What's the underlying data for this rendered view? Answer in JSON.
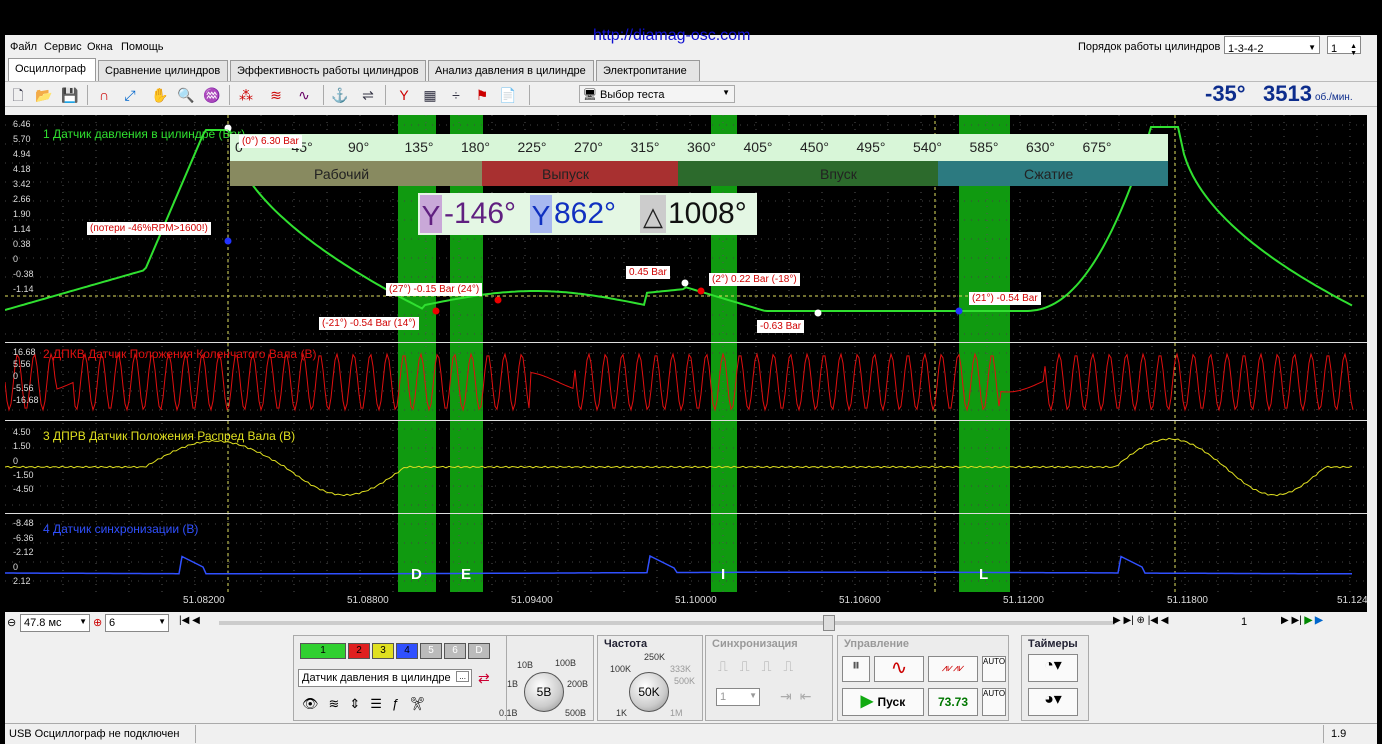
{
  "url": "http://diamag-osc.com",
  "menu": [
    "Файл",
    "Сервис",
    "Окна",
    "Помощь"
  ],
  "cyl_order": {
    "label": "Порядок работы цилиндров",
    "value": "1-3-4-2",
    "count": "1"
  },
  "tabs": [
    "Осциллограф",
    "Сравнение цилиндров",
    "Эффективность работы цилиндров",
    "Анализ давления в цилиндре",
    "Электропитание"
  ],
  "test_select": "Выбор теста",
  "readout": {
    "angle": "-35°",
    "rpm": "3513",
    "rpm_unit": "об./мин."
  },
  "channels": [
    {
      "label": "1 Датчик давления в цилиндре (Bar)",
      "color": "#30e030",
      "ticks": [
        "6.46",
        "5.70",
        "4.94",
        "4.18",
        "3.42",
        "2.66",
        "1.90",
        "1.14",
        "0.38",
        "0",
        "-0.38",
        "-1.14"
      ]
    },
    {
      "label": "2 ДПКВ Датчик Положения Коленчатого Вала (В)",
      "color": "#e01010",
      "ticks": [
        "16.68",
        "5.56",
        "0",
        "-5.56",
        "-16.68"
      ]
    },
    {
      "label": "3 ДПРВ Датчик Положения Распред Вала (В)",
      "color": "#e0e020",
      "ticks": [
        "4.50",
        "1.50",
        "0",
        "-1.50",
        "-4.50"
      ]
    },
    {
      "label": "4 Датчик синхронизации (В)",
      "color": "#3050ff",
      "ticks": [
        "-8.48",
        "-6.36",
        "-2.12",
        "0",
        "2.12"
      ]
    }
  ],
  "angle_scale": [
    "0°",
    "45°",
    "90°",
    "135°",
    "180°",
    "225°",
    "270°",
    "315°",
    "360°",
    "405°",
    "450°",
    "495°",
    "540°",
    "585°",
    "630°",
    "675°"
  ],
  "strokes": [
    "Рабочий",
    "Выпуск",
    "Впуск",
    "Сжатие"
  ],
  "cursors": {
    "left": "-146°",
    "right": "862°",
    "delta": "1008°"
  },
  "annotations": [
    "(0°) 6.30 Bar",
    "(потери -46%RPM>1600!)",
    "(27°) -0.15 Bar (24°)",
    "(-21°) -0.54 Bar (14°)",
    "0.45 Bar",
    "(2°) 0.22 Bar (-18°)",
    "-0.63 Bar",
    "(21°) -0.54 Bar"
  ],
  "bands": [
    "D",
    "E",
    "I",
    "L"
  ],
  "time_ticks": [
    "51.08200",
    "51.08800",
    "51.09400",
    "51.10000",
    "51.10600",
    "51.11200",
    "51.11800",
    "51.124"
  ],
  "bottom_bar": {
    "timebase": "47.8 мс",
    "divisions": "6",
    "page": "1"
  },
  "panels": {
    "channel": {
      "buttons": [
        "1",
        "2",
        "3",
        "4",
        "5",
        "6",
        "D"
      ],
      "name": "Датчик давления в цилиндре",
      "range_labels": [
        "10В",
        "100В",
        "1В",
        "200В",
        "0.1В",
        "500В"
      ],
      "range": "5В"
    },
    "freq": {
      "title": "Частота",
      "labels": [
        "250K",
        "100K",
        "333K",
        "500K",
        "1K",
        "1M"
      ],
      "value": "50K"
    },
    "sync": {
      "title": "Синхронизация",
      "value": "1"
    },
    "control": {
      "title": "Управление",
      "start": "Пуск",
      "fps": "73.73"
    },
    "timers": {
      "title": "Таймеры"
    }
  },
  "status": {
    "text": "USB Осциллограф не подключен",
    "version": "1.9"
  }
}
